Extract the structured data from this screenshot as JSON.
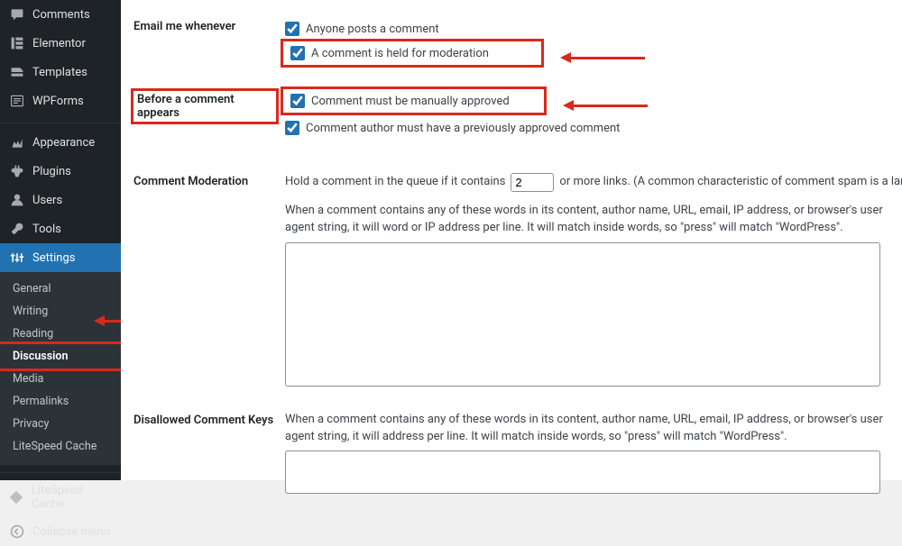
{
  "sidebar": {
    "items": [
      {
        "label": "Comments",
        "icon": "comments"
      },
      {
        "label": "Elementor",
        "icon": "elementor"
      },
      {
        "label": "Templates",
        "icon": "templates"
      },
      {
        "label": "WPForms",
        "icon": "wpforms"
      },
      {
        "label": "Appearance",
        "icon": "appearance",
        "sep": true
      },
      {
        "label": "Plugins",
        "icon": "plugins"
      },
      {
        "label": "Users",
        "icon": "users"
      },
      {
        "label": "Tools",
        "icon": "tools"
      },
      {
        "label": "Settings",
        "icon": "settings",
        "active": true
      }
    ],
    "submenu": [
      "General",
      "Writing",
      "Reading",
      "Discussion",
      "Media",
      "Permalinks",
      "Privacy",
      "LiteSpeed Cache"
    ],
    "submenu_current": "Discussion",
    "bottom": [
      {
        "label": "LiteSpeed Cache",
        "icon": "litespeed"
      },
      {
        "label": "Collapse menu",
        "icon": "collapse"
      }
    ]
  },
  "sections": {
    "email_label": "Email me whenever",
    "email_opt1": "Anyone posts a comment",
    "email_opt2": "A comment is held for moderation",
    "before_label": "Before a comment appears",
    "before_opt1": "Comment must be manually approved",
    "before_opt2": "Comment author must have a previously approved comment",
    "moderation_label": "Comment Moderation",
    "moderation_desc_pre": "Hold a comment in the queue if it contains",
    "moderation_links_value": "2",
    "moderation_desc_post": "or more links. (A common characteristic of comment spam is a large number of",
    "moderation_desc2": "When a comment contains any of these words in its content, author name, URL, email, IP address, or browser's user agent string, it will word or IP address per line. It will match inside words, so \"press\" will match \"WordPress\".",
    "disallowed_label": "Disallowed Comment Keys",
    "disallowed_desc": "When a comment contains any of these words in its content, author name, URL, email, IP address, or browser's user agent string, it will address per line. It will match inside words, so \"press\" will match \"WordPress\"."
  }
}
